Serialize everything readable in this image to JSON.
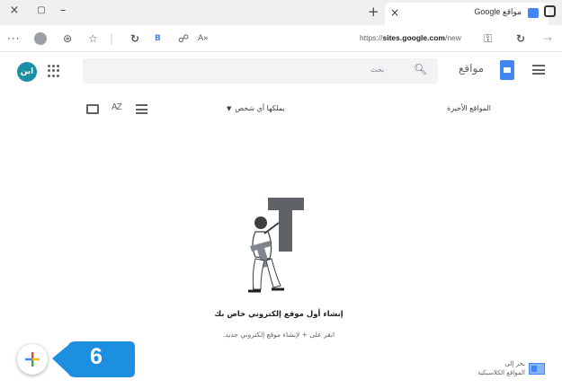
{
  "browser": {
    "tab": {
      "title": "مواقع Google",
      "close_label": "×"
    },
    "window_controls": {
      "close": "×",
      "restore": "▢",
      "minimize": "–"
    },
    "new_tab_label": "+",
    "url": {
      "prefix": "https://",
      "host": "sites.google.com",
      "path": "/new"
    }
  },
  "app": {
    "name": "مواقع",
    "user_initials": "ابن",
    "search": {
      "placeholder": "بحث"
    }
  },
  "list_header": {
    "recent_label": "المواقع الأخيرة",
    "owner_filter_label": "يملكها أي شخص",
    "sort_label": "AZ"
  },
  "empty_state": {
    "title": "إنشاء أول موقع إلكتروني خاص بك",
    "subtitle": "انقر على + لإنشاء موقع إلكتروني جديد."
  },
  "fab": {
    "label": "+"
  },
  "callout": {
    "number": "6",
    "color": "#1d8fe1"
  },
  "classic_sites": {
    "line1": "بحر إلى",
    "line2": "المواقع الكلاسيكية"
  },
  "colors": {
    "accent": "#4285f4",
    "avatar": "#1a8fa3",
    "callout": "#1d8fe1"
  }
}
